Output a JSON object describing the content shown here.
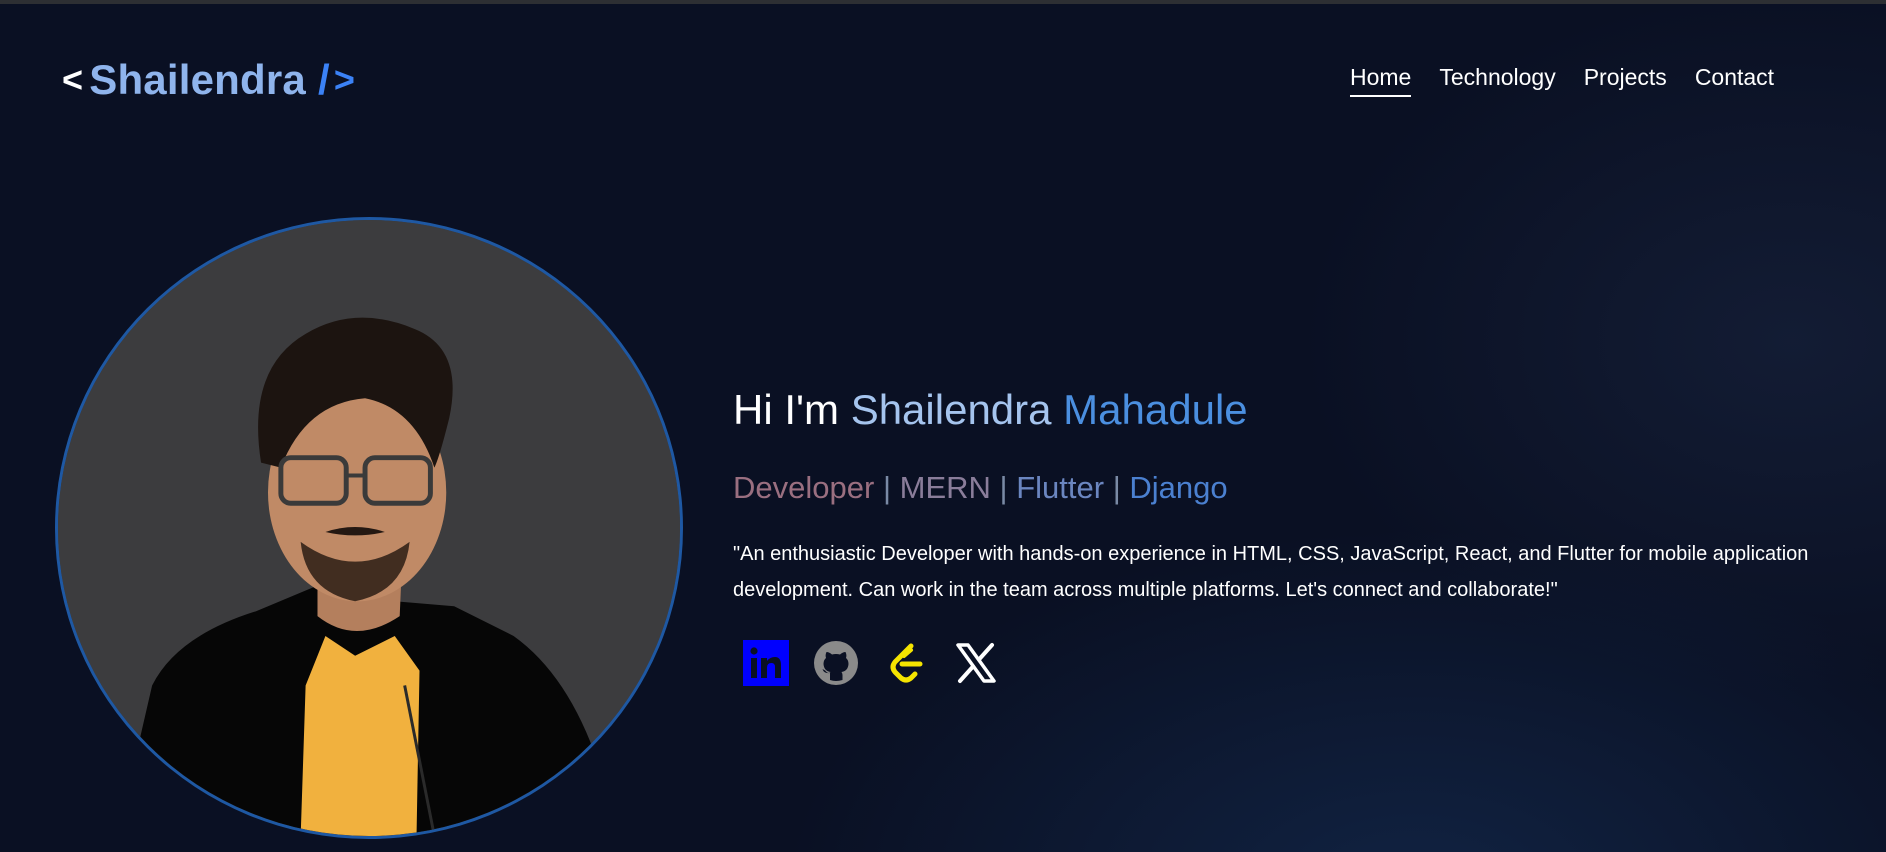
{
  "logo": {
    "open": "<",
    "name": "Shailendra",
    "slash": "/",
    "close": ">"
  },
  "nav": [
    {
      "label": "Home",
      "active": true
    },
    {
      "label": "Technology",
      "active": false
    },
    {
      "label": "Projects",
      "active": false
    },
    {
      "label": "Contact",
      "active": false
    }
  ],
  "hero": {
    "greeting_prefix": "Hi I'm",
    "first_name": "Shailendra",
    "last_name": "Mahadule",
    "roles": [
      "Developer",
      "MERN",
      "Flutter",
      "Django"
    ],
    "role_separator": "|",
    "bio": "\"An enthusiastic Developer with hands-on experience in HTML, CSS, JavaScript, React, and Flutter for mobile application development. Can work in the team across multiple platforms. Let's connect and collaborate!\""
  },
  "socials": [
    {
      "name": "linkedin-icon",
      "color": "#0000ff"
    },
    {
      "name": "github-icon",
      "color": "#8a8a8a"
    },
    {
      "name": "leetcode-icon",
      "color": "#f5e400"
    },
    {
      "name": "x-icon",
      "color": "#ffffff"
    }
  ],
  "colors": {
    "background": "#0a1023",
    "accent": "#3b82f6",
    "logo_name": "#8fb4ec"
  }
}
